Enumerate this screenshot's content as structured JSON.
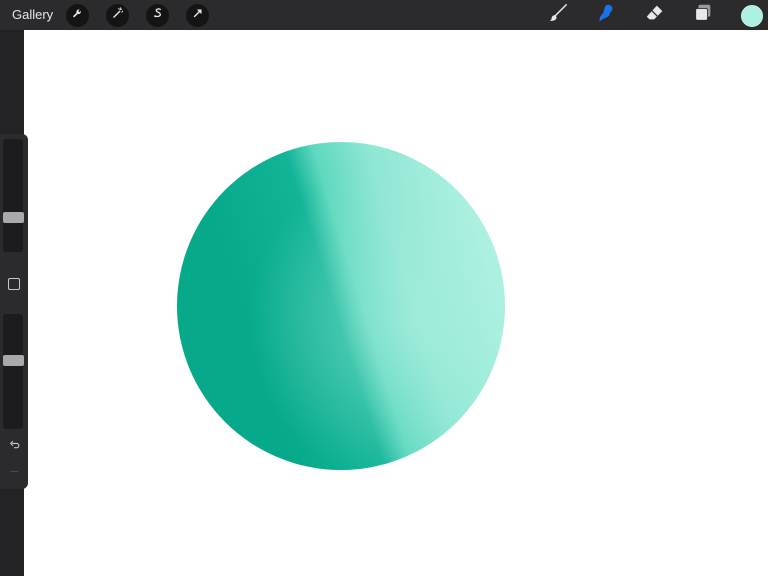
{
  "topbar": {
    "gallery_label": "Gallery",
    "left_tools": [
      "wrench-icon",
      "magic-wand-icon",
      "selection-s-icon",
      "transform-arrow-icon"
    ],
    "right_tools": [
      "brush-icon",
      "smudge-icon",
      "eraser-icon",
      "layers-icon"
    ],
    "active_tool": "smudge-icon",
    "active_color": "#aef0e1"
  },
  "sidebar": {
    "brush_size": 0.7,
    "opacity": 0.6,
    "icons": [
      "modify-square-icon",
      "undo-icon",
      "redo-icon"
    ]
  },
  "colors": {
    "accent": "#1a73e8",
    "sphere_dark": "#04a88a",
    "sphere_light": "#aef0e1",
    "toolbar": "#2b2b2d",
    "canvas": "#ffffff"
  }
}
